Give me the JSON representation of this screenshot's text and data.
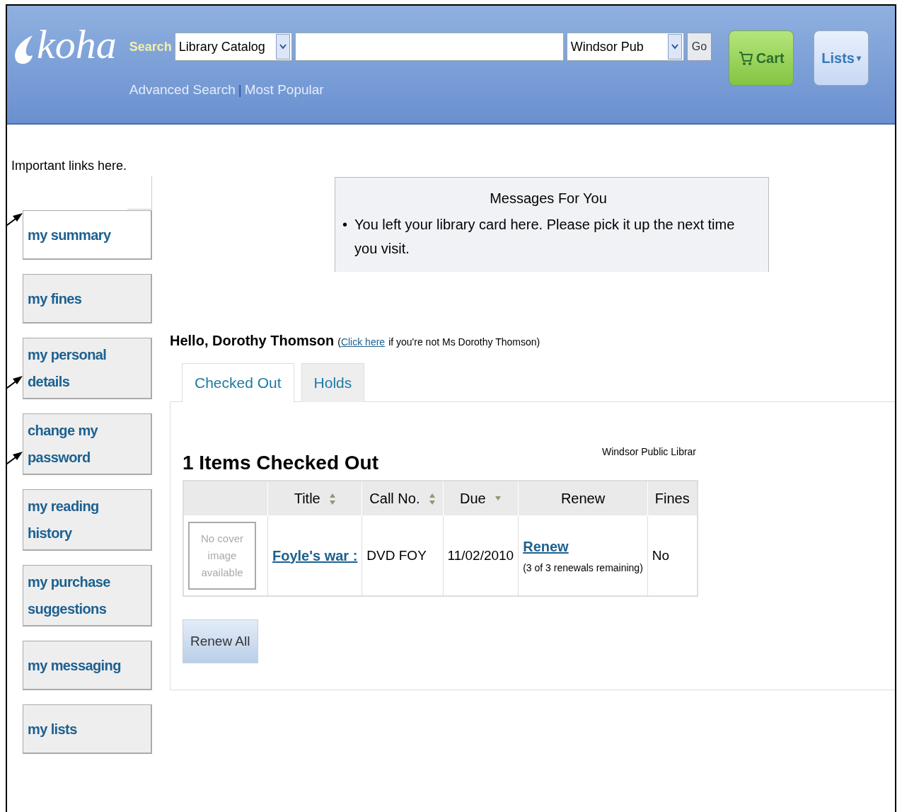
{
  "header": {
    "logo": "koha",
    "search_label": "Search",
    "search_type": "Library Catalog",
    "library": "Windsor Pub",
    "go": "Go",
    "cart": "Cart",
    "lists": "Lists",
    "lists_caret": "▾",
    "links": [
      {
        "label": "Advanced Search"
      },
      {
        "label": "Most Popular"
      }
    ],
    "link_separator": "|"
  },
  "sidebar": {
    "intro": "Important links here.",
    "items": [
      {
        "label": "my summary",
        "selected": true,
        "annotated": true
      },
      {
        "label": "my fines",
        "selected": false,
        "annotated": false
      },
      {
        "label": "my personal details",
        "selected": false,
        "annotated": true
      },
      {
        "label": "change my password",
        "selected": false,
        "annotated": true
      },
      {
        "label": "my reading history",
        "selected": false,
        "annotated": false
      },
      {
        "label": "my purchase suggestions",
        "selected": false,
        "annotated": false
      },
      {
        "label": "my messaging",
        "selected": false,
        "annotated": false
      },
      {
        "label": "my lists",
        "selected": false,
        "annotated": false
      }
    ]
  },
  "messages": {
    "title": "Messages For You",
    "bullet": "•",
    "items": [
      "You left your library card here. Please pick it up the next time you visit."
    ]
  },
  "greeting": {
    "hello": "Hello, Dorothy Thomson",
    "link": "Click here",
    "open": "(",
    "rest": "if you're not Ms Dorothy Thomson)"
  },
  "tabs": [
    {
      "label": "Checked Out",
      "selected": true
    },
    {
      "label": "Holds",
      "selected": false
    }
  ],
  "checked_out": {
    "heading": "1 Items Checked Out",
    "library": "Windsor Public Librar",
    "columns": [
      {
        "label": "Title",
        "sortable": true,
        "sorted_desc": false
      },
      {
        "label": "Call No.",
        "sortable": true,
        "sorted_desc": false
      },
      {
        "label": "Due",
        "sortable": true,
        "sorted_desc": true
      },
      {
        "label": "Renew",
        "sortable": false
      },
      {
        "label": "Fines",
        "sortable": false
      }
    ],
    "rows": [
      {
        "cover": "No cover image available",
        "title": "Foyle's war :",
        "call_no": "DVD FOY",
        "due": "11/02/2010",
        "renew": "Renew",
        "renew_note": "(3 of 3 renewals remaining)",
        "fines": "No"
      }
    ],
    "renew_all": "Renew All"
  }
}
